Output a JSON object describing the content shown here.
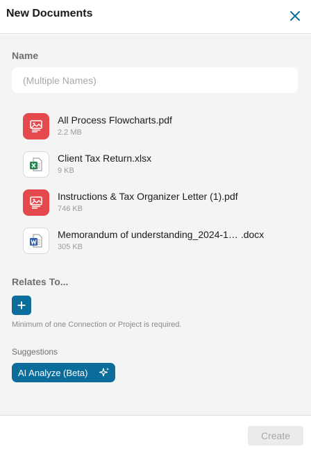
{
  "header": {
    "title": "New Documents",
    "close_icon": "close-icon"
  },
  "form": {
    "name_label": "Name",
    "name_placeholder": "(Multiple Names)",
    "name_value": ""
  },
  "files": [
    {
      "name": "All Process Flowcharts.pdf",
      "size": "2.2 MB",
      "type": "pdf",
      "icon": "pdf-file-icon"
    },
    {
      "name": "Client Tax Return.xlsx",
      "size": "9 KB",
      "type": "excel",
      "icon": "excel-file-icon"
    },
    {
      "name": "Instructions & Tax Organizer Letter (1).pdf",
      "size": "746 KB",
      "type": "pdf",
      "icon": "pdf-file-icon"
    },
    {
      "name": "Memorandum of understanding_2024-1… .docx",
      "size": "305 KB",
      "type": "word",
      "icon": "word-file-icon"
    }
  ],
  "relates": {
    "label": "Relates To...",
    "hint": "Minimum of one Connection or Project is required."
  },
  "suggestions": {
    "label": "Suggestions",
    "ai_button": "AI Analyze (Beta)"
  },
  "footer": {
    "create_label": "Create"
  },
  "colors": {
    "accent": "#0b6d9c",
    "pdf": "#e5484d",
    "excel": "#1e8a4c",
    "word": "#2f5fb3"
  }
}
